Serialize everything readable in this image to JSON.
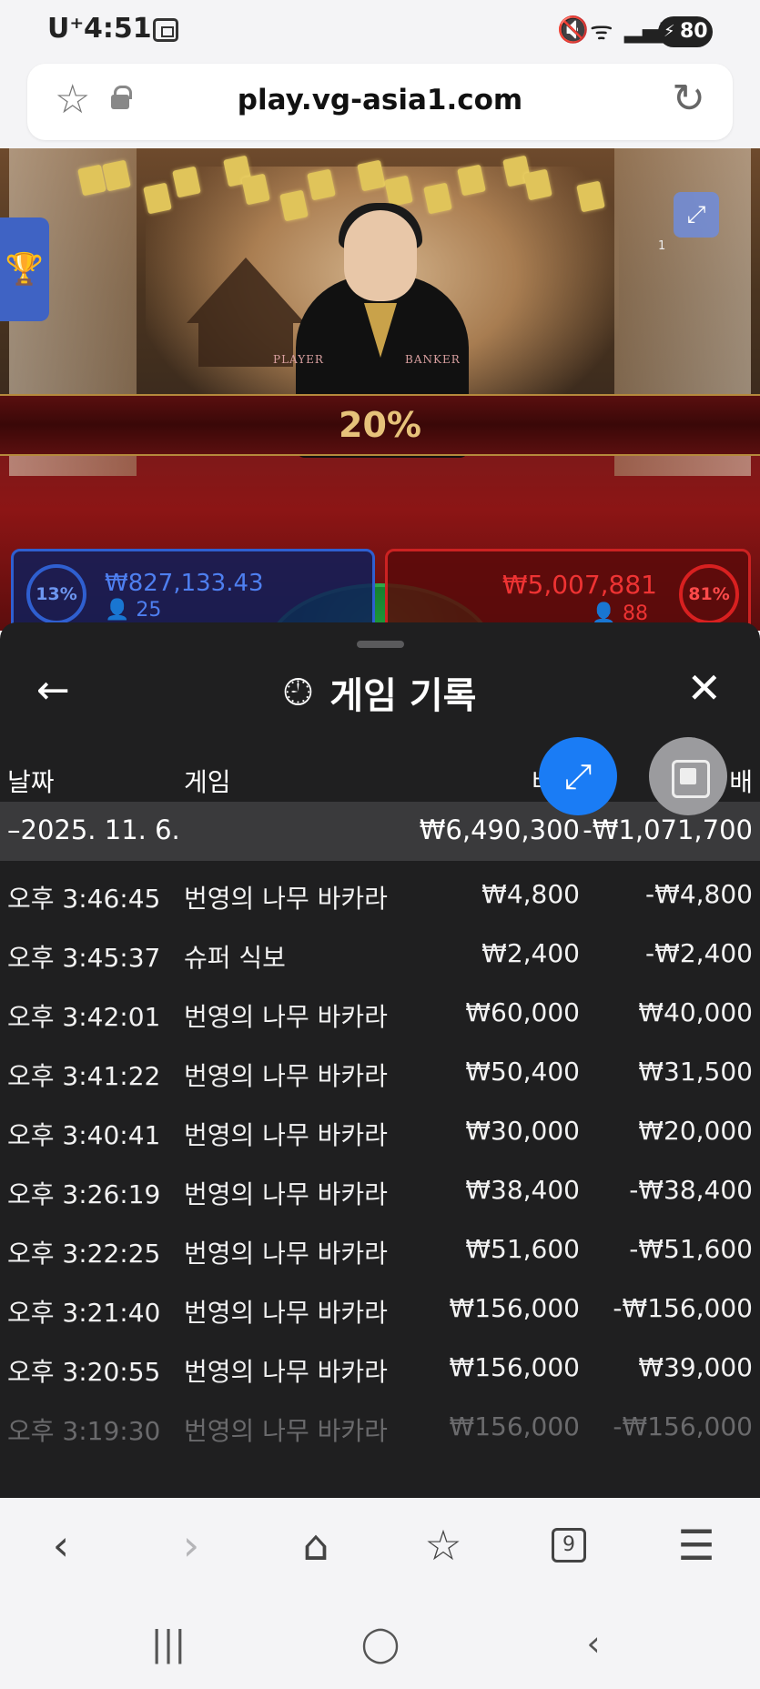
{
  "status_bar": {
    "carrier": "U⁺",
    "time": "4:51",
    "battery": "80"
  },
  "browser": {
    "url": "play.vg-asia1.com",
    "tab_count": "9"
  },
  "game": {
    "percent_banner": "20%",
    "table_labels": {
      "player": "PLAYER",
      "banker": "BANKER"
    },
    "expand_count": "1",
    "player": {
      "percent": "13%",
      "amount": "₩827,133.43",
      "count": "25"
    },
    "banker": {
      "percent": "81%",
      "amount": "₩5,007,881",
      "count": "88"
    }
  },
  "history": {
    "title": "게임 기록",
    "columns": {
      "date": "날짜",
      "game": "게임",
      "bet": "배",
      "payout": "배"
    },
    "date_group": {
      "date": "–2025. 11. 6.",
      "bet": "₩6,490,300",
      "payout": "-₩1,071,700"
    },
    "rows": [
      {
        "time": "오후 3:46:45",
        "game": "번영의 나무 바카라",
        "bet": "₩4,800",
        "payout": "-₩4,800"
      },
      {
        "time": "오후 3:45:37",
        "game": "슈퍼 식보",
        "bet": "₩2,400",
        "payout": "-₩2,400"
      },
      {
        "time": "오후 3:42:01",
        "game": "번영의 나무 바카라",
        "bet": "₩60,000",
        "payout": "₩40,000"
      },
      {
        "time": "오후 3:41:22",
        "game": "번영의 나무 바카라",
        "bet": "₩50,400",
        "payout": "₩31,500"
      },
      {
        "time": "오후 3:40:41",
        "game": "번영의 나무 바카라",
        "bet": "₩30,000",
        "payout": "₩20,000"
      },
      {
        "time": "오후 3:26:19",
        "game": "번영의 나무 바카라",
        "bet": "₩38,400",
        "payout": "-₩38,400"
      },
      {
        "time": "오후 3:22:25",
        "game": "번영의 나무 바카라",
        "bet": "₩51,600",
        "payout": "-₩51,600"
      },
      {
        "time": "오후 3:21:40",
        "game": "번영의 나무 바카라",
        "bet": "₩156,000",
        "payout": "-₩156,000"
      },
      {
        "time": "오후 3:20:55",
        "game": "번영의 나무 바카라",
        "bet": "₩156,000",
        "payout": "₩39,000"
      },
      {
        "time": "오후 3:19:30",
        "game": "번영의 나무 바카라",
        "bet": "₩156,000",
        "payout": "-₩156,000"
      }
    ]
  },
  "icons": {
    "back": "left-arrow-icon",
    "history": "history-clock-icon",
    "close": "close-x-icon",
    "fab_expand": "diagonal-expand-icon",
    "fab_pip": "picture-in-picture-icon"
  },
  "colors": {
    "panel_bg": "#1f1f20",
    "date_row_bg": "#3a3a3c",
    "fab_blue": "#1a7cf5",
    "player_blue": "#2f5fd0",
    "banker_red": "#cc2222",
    "gold": "#e6c27a"
  }
}
